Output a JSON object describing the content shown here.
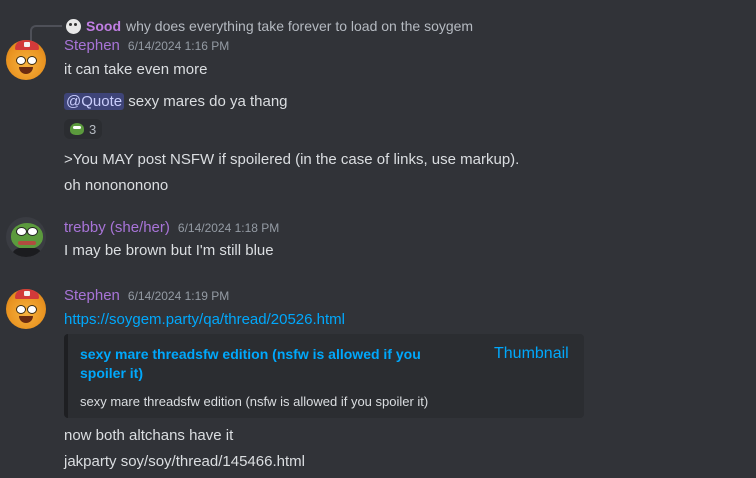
{
  "reply": {
    "author": "Sood",
    "text": "why does everything take forever to load on the soygem"
  },
  "groups": {
    "g1": {
      "author": "Stephen",
      "timestamp": "6/14/2024 1:16 PM",
      "messages": [
        "it can take even more",
        "sexy mares do ya thang",
        ">You MAY post NSFW if spoilered (in the case of links, use markup).",
        "oh nonononono"
      ],
      "mention": "@Quote",
      "reaction": {
        "emoji": "pepe-emoji",
        "count": "3"
      }
    },
    "g2": {
      "author": "trebby (she/her)",
      "timestamp": "6/14/2024 1:18 PM",
      "messages": [
        "I may be brown but I'm still blue"
      ]
    },
    "g3": {
      "author": "Stephen",
      "timestamp": "6/14/2024 1:19 PM",
      "link": "https://soygem.party/qa/thread/20526.html",
      "embed": {
        "title": "sexy mare threadsfw edition (nsfw is allowed if you spoiler it)",
        "thumbnail": "Thumbnail",
        "description": "sexy mare threadsfw edition (nsfw is allowed if you spoiler it)"
      },
      "messages": [
        "now both altchans have it",
        "jakparty soy/soy/thread/145466.html"
      ]
    }
  },
  "colors": {
    "background": "#313338",
    "username": "#a874d8",
    "link": "#00a8fc",
    "timestamp": "#949ba4"
  }
}
